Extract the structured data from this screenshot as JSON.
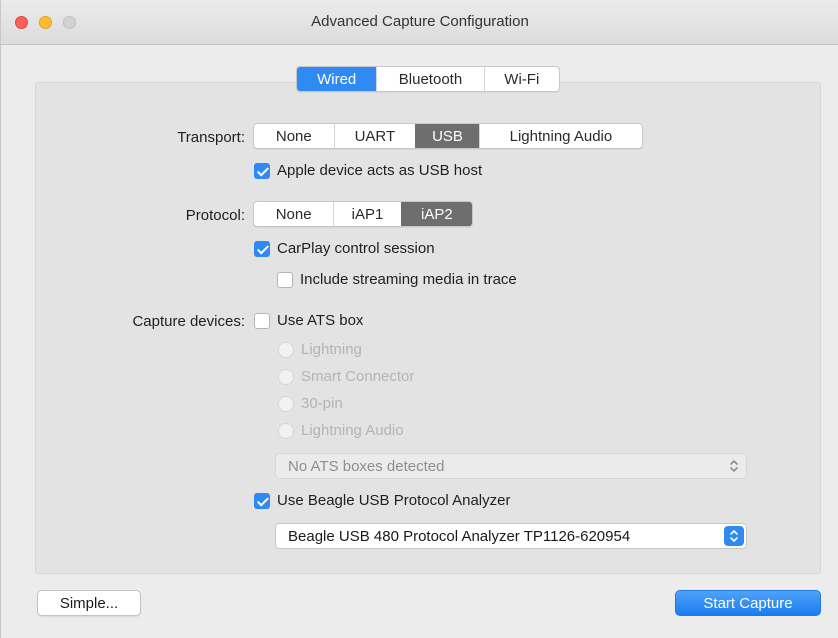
{
  "window": {
    "title": "Advanced Capture Configuration"
  },
  "connection_tabs": {
    "items": [
      "Wired",
      "Bluetooth",
      "Wi-Fi"
    ],
    "selected": "Wired"
  },
  "transport": {
    "label": "Transport:",
    "options": [
      "None",
      "UART",
      "USB",
      "Lightning Audio"
    ],
    "selected": "USB",
    "usb_host": {
      "label": "Apple device acts as USB host",
      "checked": true
    }
  },
  "protocol": {
    "label": "Protocol:",
    "options": [
      "None",
      "iAP1",
      "iAP2"
    ],
    "selected": "iAP2",
    "carplay": {
      "label": "CarPlay control session",
      "checked": true
    },
    "streaming": {
      "label": "Include streaming media in trace",
      "checked": false
    }
  },
  "capture_devices": {
    "label": "Capture devices:",
    "use_ats": {
      "label": "Use ATS box",
      "checked": false
    },
    "ats_ports": [
      "Lightning",
      "Smart Connector",
      "30-pin",
      "Lightning Audio"
    ],
    "ats_popup": "No ATS boxes detected",
    "use_beagle": {
      "label": "Use Beagle USB Protocol Analyzer",
      "checked": true
    },
    "beagle_popup": "Beagle USB 480 Protocol Analyzer TP1126-620954"
  },
  "footer": {
    "simple_label": "Simple...",
    "start_label": "Start Capture"
  },
  "colors": {
    "accent": "#2f8bf3",
    "segment_selected": "#6e6e6e",
    "window_bg": "#ececec"
  }
}
